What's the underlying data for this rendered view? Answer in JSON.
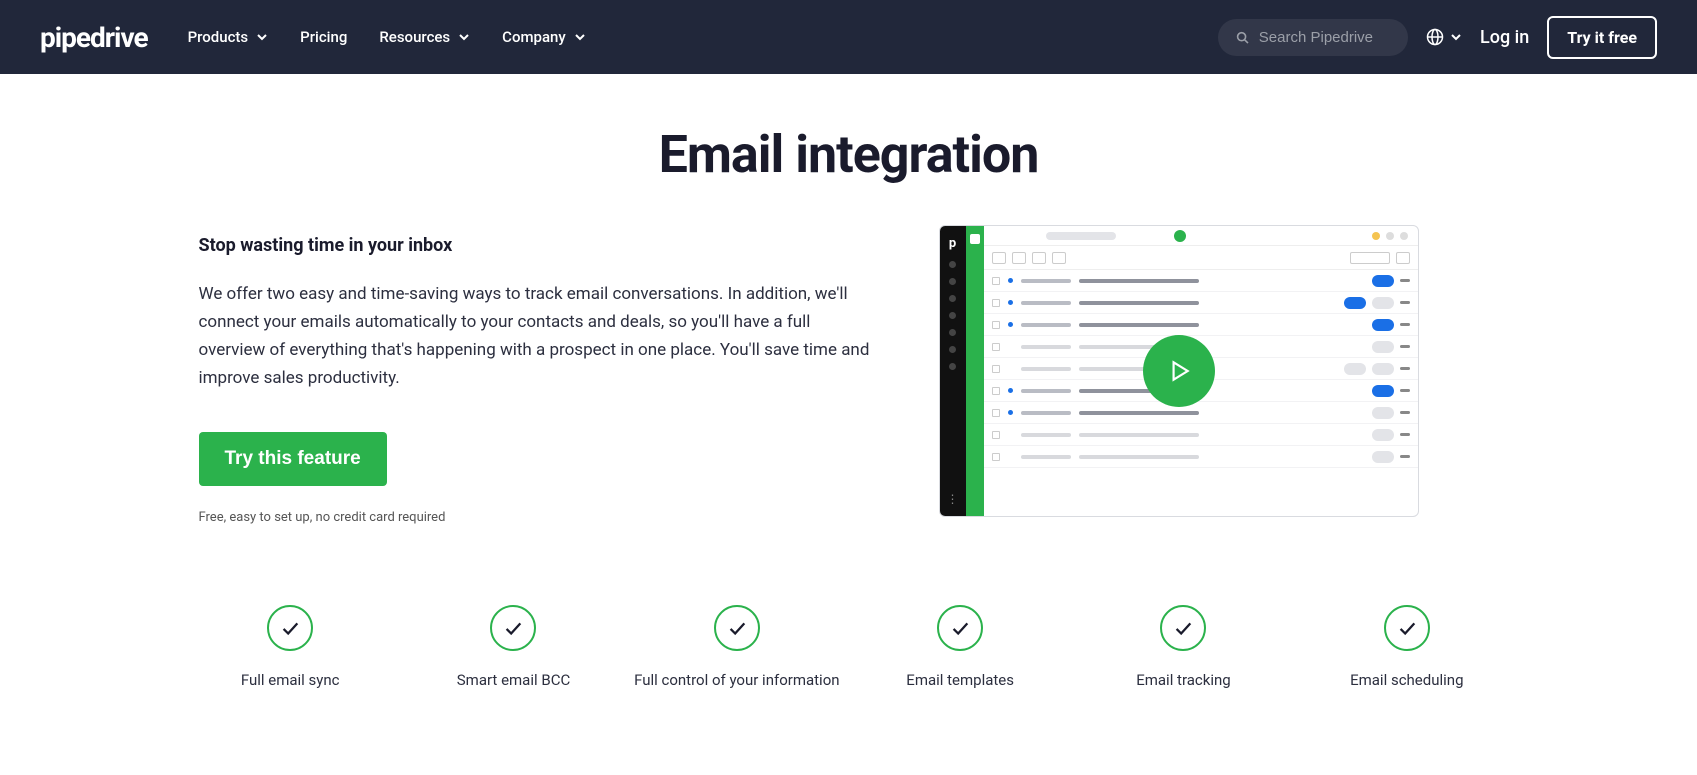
{
  "brand": "pipedrive",
  "nav": {
    "products": "Products",
    "pricing": "Pricing",
    "resources": "Resources",
    "company": "Company"
  },
  "search": {
    "placeholder": "Search Pipedrive"
  },
  "login": "Log in",
  "try_free": "Try it free",
  "hero": {
    "title": "Email integration",
    "subhead": "Stop wasting time in your inbox",
    "body": "We offer two easy and time-saving ways to track email conversations. In addition, we'll connect your emails automatically to your contacts and deals, so you'll have a full overview of everything that's happening with a prospect in one place. You'll save time and improve sales productivity.",
    "cta": "Try this feature",
    "cta_sub": "Free, easy to set up, no credit card required"
  },
  "features": [
    "Full email sync",
    "Smart email BCC",
    "Full control of your information",
    "Email templates",
    "Email tracking",
    "Email scheduling"
  ]
}
